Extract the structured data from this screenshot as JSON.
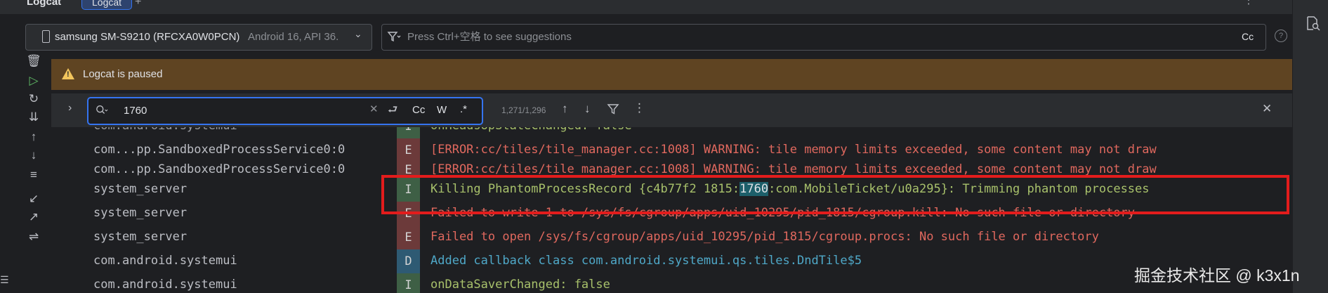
{
  "tabbar": {
    "title": "Logcat",
    "tab_label": "Logcat",
    "add": "+",
    "more": "⋮"
  },
  "device": {
    "name": "samsung SM-S9210 (RFCXA0W0PCN)",
    "api": "Android 16, API 36.",
    "chevron": "⌄"
  },
  "filter": {
    "placeholder": "Press Ctrl+空格 to see suggestions",
    "cc": "Cc",
    "help": "?"
  },
  "banner": {
    "text": "Logcat is paused"
  },
  "search": {
    "value": "1760",
    "cc": "Cc",
    "whole_word": "W",
    "regex": ".*",
    "match_count": "1,271/1,296"
  },
  "rows": [
    {
      "tag": "com...pp.SandboxedProcessService0:0",
      "level": "E",
      "message": "[ERROR:cc/tiles/tile_manager.cc:1008] WARNING: tile memory limits exceeded, some content may not draw"
    },
    {
      "tag": "com...pp.SandboxedProcessService0:0",
      "level": "E",
      "message": "[ERROR:cc/tiles/tile_manager.cc:1008] WARNING: tile memory limits exceeded, some content may not draw"
    },
    {
      "tag": "system_server",
      "level": "I",
      "message_pre": "Killing PhantomProcessRecord {c4b77f2 1815:",
      "message_match": "1760",
      "message_post": ":com.MobileTicket/u0a295}: Trimming phantom processes"
    },
    {
      "tag": "system_server",
      "level": "E",
      "message": "Failed to write 1 to /sys/fs/cgroup/apps/uid_10295/pid_1815/cgroup.kill: No such file or directory"
    },
    {
      "tag": "system_server",
      "level": "E",
      "message": "Failed to open /sys/fs/cgroup/apps/uid_10295/pid_1815/cgroup.procs: No such file or directory"
    },
    {
      "tag": "com.android.systemui",
      "level": "D",
      "message": "Added callback class com.android.systemui.qs.tiles.DndTile$5"
    },
    {
      "tag": "com.android.systemui",
      "level": "I",
      "message": "onDataSaverChanged: false"
    }
  ],
  "watermark": "掘金技术社区 @ k3x1n",
  "colors": {
    "accent": "#3574f0",
    "banner_bg": "#5f4422",
    "error_text": "#e0685e",
    "info_text": "#a8c16b",
    "debug_text": "#4fa8c8",
    "highlight_box": "#e31c1c"
  }
}
